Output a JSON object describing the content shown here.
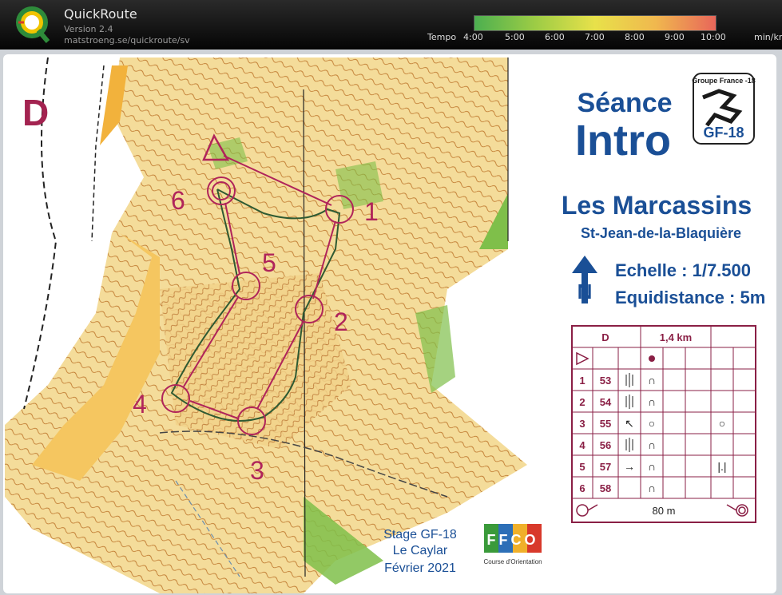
{
  "app": {
    "title": "QuickRoute",
    "version": "Version 2.4",
    "url": "matstroeng.se/quickroute/sv"
  },
  "tempo": {
    "label": "Tempo",
    "ticks": [
      "4:00",
      "5:00",
      "6:00",
      "7:00",
      "8:00",
      "9:00",
      "10:00"
    ],
    "unit": "min/km",
    "gradient_colors": [
      "#4caf50",
      "#9ccc45",
      "#e8e14a",
      "#f0b84e",
      "#e8665a"
    ]
  },
  "map": {
    "class_letter": "D",
    "session_line1": "Séance",
    "session_line2": "Intro",
    "logo_group": "Groupe France -18",
    "logo_badge": "GF-18",
    "terrain_name": "Les Marcassins",
    "location": "St-Jean-de-la-Blaquière",
    "scale": "Echelle : 1/7.500",
    "equidistance": "Equidistance : 5m",
    "stage_line1": "Stage GF-18",
    "stage_line2": "Le Caylar",
    "stage_line3": "Février 2021",
    "ffco_caption": "Course d'Orientation",
    "ffco_letters": "FFCO",
    "control_numbers": [
      "1",
      "2",
      "3",
      "4",
      "5",
      "6"
    ],
    "colors": {
      "course": "#b0245a",
      "title_blue": "#1a4f96",
      "terrain": "#f6d58a",
      "forest": "#7fbf4a"
    }
  },
  "descriptions": {
    "header_class": "D",
    "header_length": "1,4 km",
    "rows": [
      {
        "num": "1",
        "code": "53",
        "dir": "",
        "feature": "∩",
        "extra": ""
      },
      {
        "num": "2",
        "code": "54",
        "dir": "",
        "feature": "∩",
        "extra": ""
      },
      {
        "num": "3",
        "code": "55",
        "dir": "↖",
        "feature": "○",
        "extra": "○"
      },
      {
        "num": "4",
        "code": "56",
        "dir": "",
        "feature": "∩",
        "extra": ""
      },
      {
        "num": "5",
        "code": "57",
        "dir": "→",
        "feature": "∩",
        "extra": "|.|"
      },
      {
        "num": "6",
        "code": "58",
        "dir": "",
        "feature": "∩",
        "extra": ""
      }
    ],
    "finish_distance": "80 m"
  }
}
